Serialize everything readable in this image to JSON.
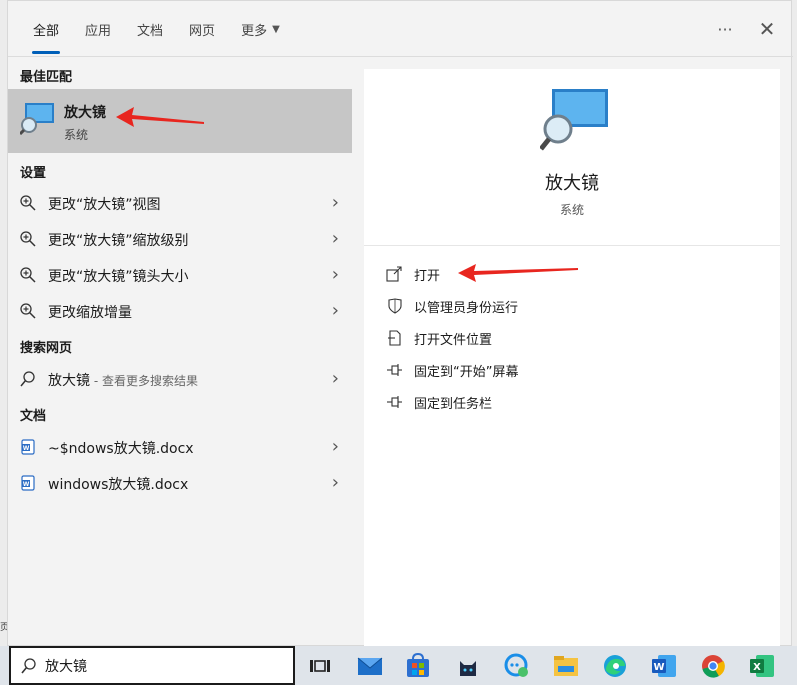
{
  "tabs": [
    {
      "label": "全部",
      "active": true
    },
    {
      "label": "应用"
    },
    {
      "label": "文档"
    },
    {
      "label": "网页"
    },
    {
      "label": "更多",
      "dropdown": true
    }
  ],
  "top_actions": {
    "more": "···",
    "close": "✕"
  },
  "sections": {
    "best_match": "最佳匹配",
    "settings": "设置",
    "web": "搜索网页",
    "docs": "文档"
  },
  "best_match": {
    "title": "放大镜",
    "subtitle": "系统",
    "icon": "magnifier-app-icon"
  },
  "settings_items": [
    {
      "label": "更改“放大镜”视图"
    },
    {
      "label": "更改“放大镜”缩放级别"
    },
    {
      "label": "更改“放大镜”镜头大小"
    },
    {
      "label": "更改缩放增量"
    }
  ],
  "web_item": {
    "label": "放大镜",
    "sub": " - 查看更多搜索结果"
  },
  "doc_items": [
    {
      "label": "~$ndows放大镜.docx"
    },
    {
      "label": "windows放大镜.docx"
    }
  ],
  "detail": {
    "title": "放大镜",
    "subtitle": "系统",
    "actions": [
      {
        "label": "打开",
        "icon": "open-icon"
      },
      {
        "label": "以管理员身份运行",
        "icon": "shield-icon"
      },
      {
        "label": "打开文件位置",
        "icon": "file-location-icon"
      },
      {
        "label": "固定到“开始”屏幕",
        "icon": "pin-icon"
      },
      {
        "label": "固定到任务栏",
        "icon": "pin-icon"
      }
    ]
  },
  "taskbar": {
    "search_value": "放大镜",
    "left_edge_text": "页"
  },
  "colors": {
    "accent": "#005fb8",
    "arrow": "#e8261f",
    "selected_row": "#c6c6c6"
  }
}
